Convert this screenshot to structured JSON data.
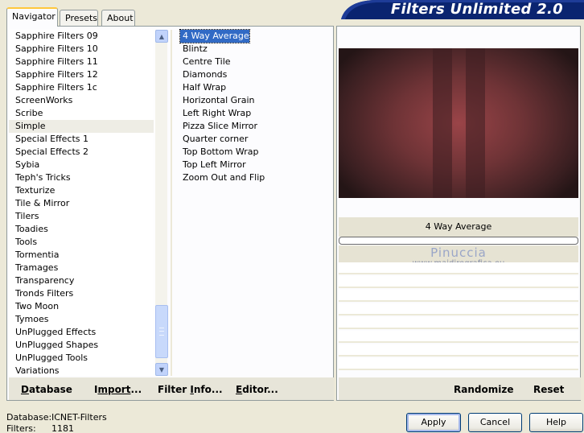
{
  "app_title": "Filters Unlimited 2.0",
  "tabs": [
    {
      "label": "Navigator",
      "active": true
    },
    {
      "label": "Presets",
      "active": false
    },
    {
      "label": "About",
      "active": false
    }
  ],
  "categories": [
    "Sapphire Filters 09",
    "Sapphire Filters 10",
    "Sapphire Filters 11",
    "Sapphire Filters 12",
    "Sapphire Filters 1c",
    "ScreenWorks",
    "Scribe",
    "Simple",
    "Special Effects 1",
    "Special Effects 2",
    "Sybia",
    "Teph's Tricks",
    "Texturize",
    "Tile & Mirror",
    "Tilers",
    "Toadies",
    "Tools",
    "Tormentia",
    "Tramages",
    "Transparency",
    "Tronds Filters",
    "Two Moon",
    "Tymoes",
    "UnPlugged Effects",
    "UnPlugged Shapes",
    "UnPlugged Tools",
    "Variations"
  ],
  "selected_category": "Simple",
  "filters": [
    "4 Way Average",
    "Blintz",
    "Centre Tile",
    "Diamonds",
    "Half Wrap",
    "Horizontal Grain",
    "Left Right Wrap",
    "Pizza Slice Mirror",
    "Quarter corner",
    "Top Bottom Wrap",
    "Top Left Mirror",
    "Zoom Out and Flip"
  ],
  "selected_filter": "4 Way Average",
  "preview_filter_name": "4 Way Average",
  "watermark": {
    "name": "Pinuccia",
    "url": "www.maidiregrafica.eu"
  },
  "left_toolbar": {
    "database": {
      "u": "D",
      "rest": "atabase"
    },
    "import": {
      "u": "I",
      "mid": "mport",
      "rest": "..."
    },
    "filter_info": {
      "pre": "Filter ",
      "u": "I",
      "rest": "nfo..."
    },
    "editor": {
      "u": "E",
      "rest": "ditor..."
    }
  },
  "right_toolbar": {
    "randomize": "Randomize",
    "reset": "Reset"
  },
  "status": {
    "database_label": "Database:",
    "database_value": "ICNET-Filters",
    "filters_label": "Filters:",
    "filters_value": "1181"
  },
  "buttons": {
    "apply": "Apply",
    "cancel": "Cancel",
    "help": "Help"
  },
  "colors": {
    "selection": "#316ac5",
    "banner": "#0a2470",
    "tab_accent": "#ffc73c"
  }
}
